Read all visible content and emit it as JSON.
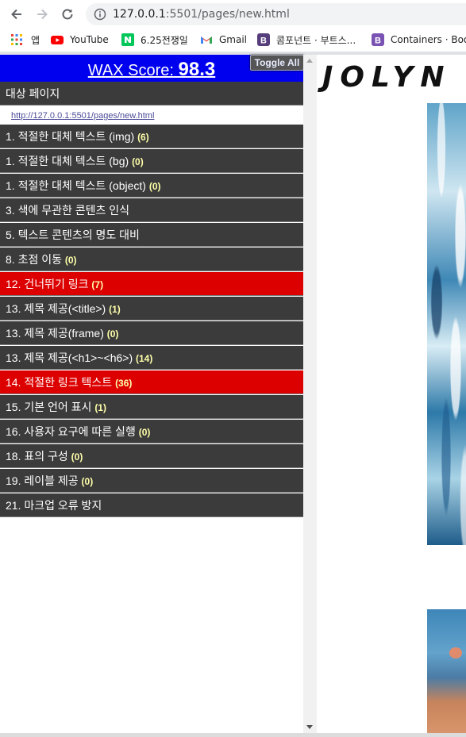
{
  "browser": {
    "url_host": "127.0.0.1",
    "url_path": ":5501/pages/new.html",
    "bookmarks": [
      {
        "label": "앱",
        "icon": "apps-grid-icon"
      },
      {
        "label": "YouTube",
        "icon": "youtube-icon"
      },
      {
        "label": "6.25전쟁일",
        "icon": "naver-icon"
      },
      {
        "label": "Gmail",
        "icon": "gmail-icon"
      },
      {
        "label": "콤포넌트 · 부트스...",
        "icon": "bootstrap-icon"
      },
      {
        "label": "Containers · Boot",
        "icon": "bootstrap-icon"
      }
    ]
  },
  "wax": {
    "score_label": "WAX Score:",
    "score_value": "98.3",
    "toggle_label": "Toggle All",
    "target_heading": "대상 페이지",
    "target_url": "http://127.0.0.1:5501/pages/new.html",
    "items": [
      {
        "label": "1. 적절한 대체 텍스트 (img)",
        "count": "(6)",
        "status": "normal"
      },
      {
        "label": "1. 적절한 대체 텍스트 (bg)",
        "count": "(0)",
        "status": "normal"
      },
      {
        "label": "1. 적절한 대체 텍스트 (object)",
        "count": "(0)",
        "status": "normal"
      },
      {
        "label": "3. 색에 무관한 콘텐츠 인식",
        "count": "",
        "status": "normal"
      },
      {
        "label": "5. 텍스트 콘텐츠의 명도 대비",
        "count": "",
        "status": "normal"
      },
      {
        "label": "8. 초점 이동",
        "count": "(0)",
        "status": "normal"
      },
      {
        "label": "12. 건너뛰기 링크",
        "count": "(7)",
        "status": "error"
      },
      {
        "label": "13. 제목 제공(<title>)",
        "count": "(1)",
        "status": "normal"
      },
      {
        "label": "13. 제목 제공(frame)",
        "count": "(0)",
        "status": "normal"
      },
      {
        "label": "13. 제목 제공(<h1>~<h6>)",
        "count": "(14)",
        "status": "normal"
      },
      {
        "label": "14. 적절한 링크 텍스트",
        "count": "(36)",
        "status": "error"
      },
      {
        "label": "15. 기본 언어 표시",
        "count": "(1)",
        "status": "normal"
      },
      {
        "label": "16. 사용자 요구에 따른 실행",
        "count": "(0)",
        "status": "normal"
      },
      {
        "label": "18. 표의 구성",
        "count": "(0)",
        "status": "normal"
      },
      {
        "label": "19. 레이블 제공",
        "count": "(0)",
        "status": "normal"
      },
      {
        "label": "21. 마크업 오류 방지",
        "count": "",
        "status": "normal"
      }
    ]
  },
  "page": {
    "logo": "JOLYN"
  },
  "colors": {
    "wax_header": "#0000ee",
    "row_bg": "#3b3b3b",
    "row_error": "#dd0000",
    "count_text": "#ffffaa"
  }
}
